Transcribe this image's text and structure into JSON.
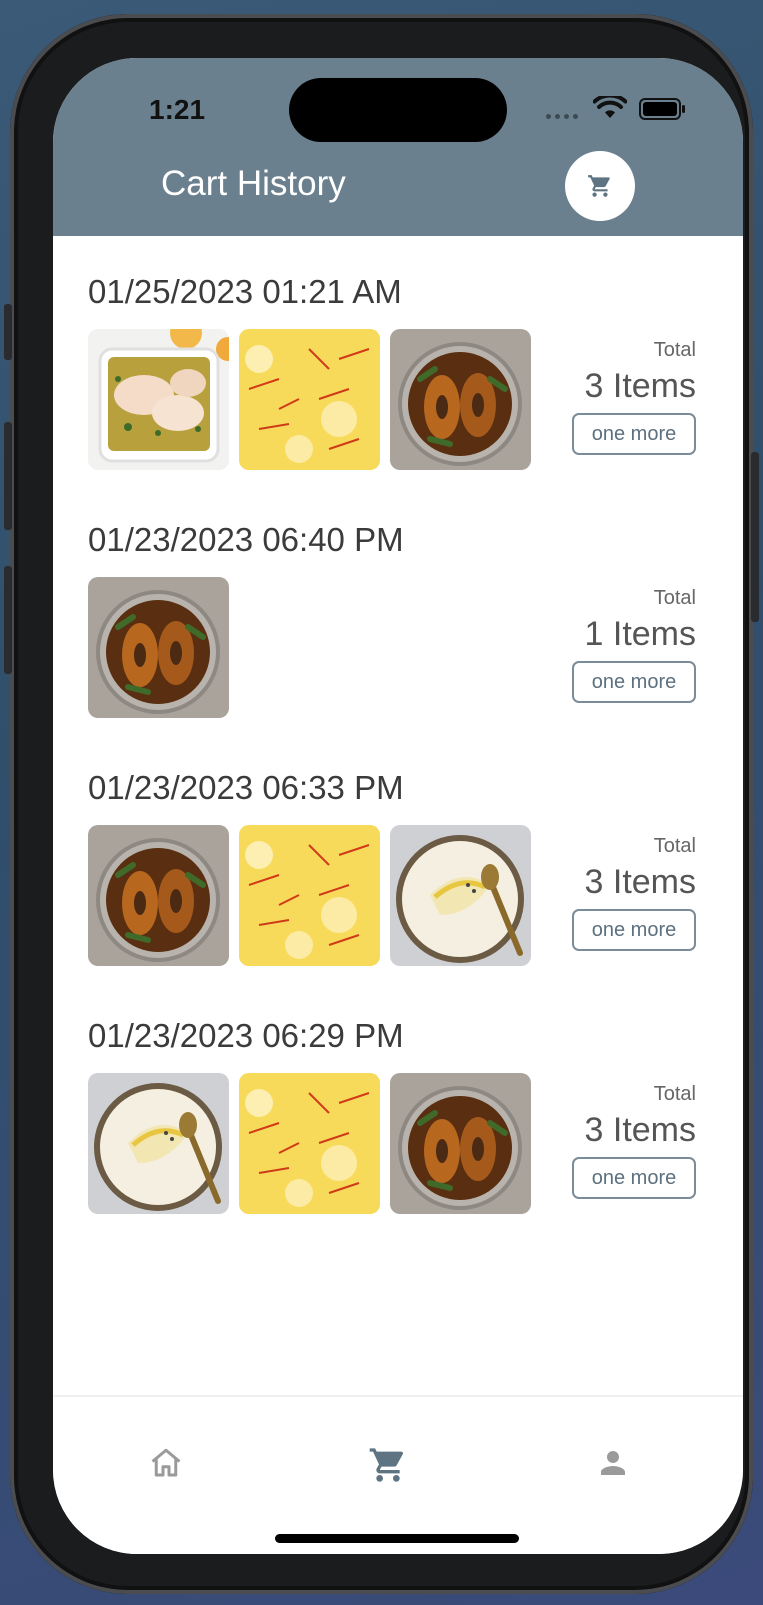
{
  "status_bar": {
    "time": "1:21"
  },
  "header": {
    "title": "Cart History",
    "cart_icon": "cart-icon"
  },
  "orders": [
    {
      "date": "01/25/2023 01:21 AM",
      "total_label": "Total",
      "count_text": "3 Items",
      "button_label": "one more",
      "items": [
        "chicken-dish",
        "saffron-rice",
        "fish-curry"
      ]
    },
    {
      "date": "01/23/2023 06:40 PM",
      "total_label": "Total",
      "count_text": "1 Items",
      "button_label": "one more",
      "items": [
        "fish-curry"
      ]
    },
    {
      "date": "01/23/2023 06:33 PM",
      "total_label": "Total",
      "count_text": "3 Items",
      "button_label": "one more",
      "items": [
        "fish-curry",
        "saffron-rice",
        "mashed-potato"
      ]
    },
    {
      "date": "01/23/2023 06:29 PM",
      "total_label": "Total",
      "count_text": "3 Items",
      "button_label": "one more",
      "items": [
        "mashed-potato",
        "saffron-rice",
        "fish-curry"
      ]
    }
  ],
  "bottom_nav": {
    "items": [
      {
        "name": "home",
        "icon": "home-icon",
        "active": false
      },
      {
        "name": "cart",
        "icon": "cart-icon",
        "active": true
      },
      {
        "name": "profile",
        "icon": "person-icon",
        "active": false
      }
    ]
  },
  "colors": {
    "header_bg": "#6a808e",
    "accent": "#5c7080",
    "nav_inactive": "#9a9a9a",
    "nav_active": "#5f7482"
  }
}
